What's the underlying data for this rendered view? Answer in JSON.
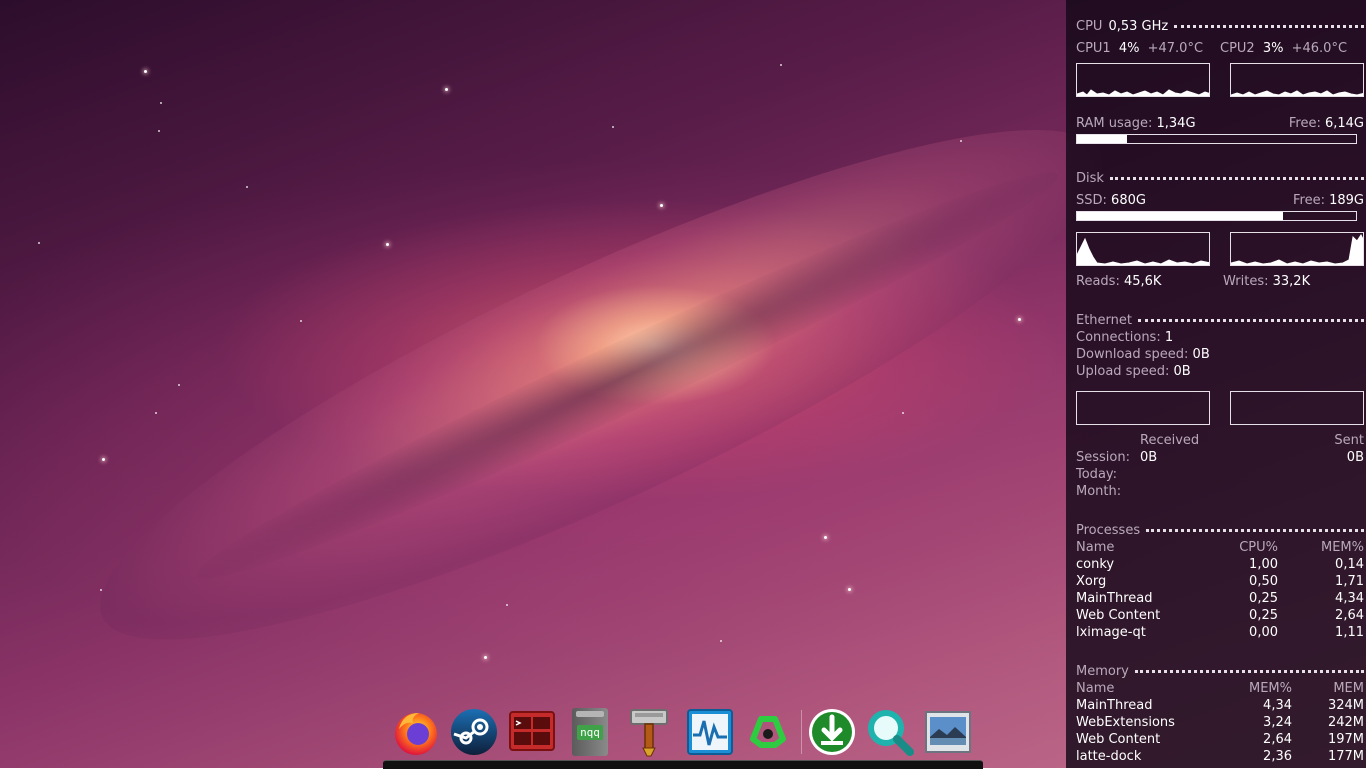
{
  "conky": {
    "cpu": {
      "header_label": "CPU",
      "freq": "0,53 GHz",
      "core1_label": "CPU1",
      "core1_usage": "4%",
      "core1_temp": "+47.0°C",
      "core2_label": "CPU2",
      "core2_usage": "3%",
      "core2_temp": "+46.0°C"
    },
    "ram": {
      "usage_label": "RAM usage:",
      "usage_value": "1,34G",
      "free_label": "Free:",
      "free_value": "6,14G",
      "used_fraction": 0.18
    },
    "disk": {
      "header_label": "Disk",
      "ssd_label": "SSD:",
      "ssd_value": "680G",
      "free_label": "Free:",
      "free_value": "189G",
      "used_fraction": 0.74,
      "reads_label": "Reads:",
      "reads_value": "45,6K",
      "writes_label": "Writes:",
      "writes_value": "33,2K"
    },
    "ethernet": {
      "header_label": "Ethernet",
      "connections_label": "Connections:",
      "connections_value": "1",
      "download_label": "Download speed:",
      "download_value": "0B",
      "upload_label": "Upload speed:",
      "upload_value": "0B",
      "received_label": "Received",
      "sent_label": "Sent",
      "session_label": "Session:",
      "session_received": "0B",
      "session_sent": "0B",
      "today_label": "Today:",
      "month_label": "Month:"
    },
    "processes": {
      "header_label": "Processes",
      "columns": [
        "Name",
        "CPU%",
        "MEM%"
      ],
      "rows": [
        {
          "name": "conky",
          "cpu": "1,00",
          "mem": "0,14"
        },
        {
          "name": "Xorg",
          "cpu": "0,50",
          "mem": "1,71"
        },
        {
          "name": "MainThread",
          "cpu": "0,25",
          "mem": "4,34"
        },
        {
          "name": "Web Content",
          "cpu": "0,25",
          "mem": "2,64"
        },
        {
          "name": "lximage-qt",
          "cpu": "0,00",
          "mem": "1,11"
        }
      ]
    },
    "memory": {
      "header_label": "Memory",
      "columns": [
        "Name",
        "MEM%",
        "MEM"
      ],
      "rows": [
        {
          "name": "MainThread",
          "pct": "4,34",
          "mem": "324M"
        },
        {
          "name": "WebExtensions",
          "pct": "3,24",
          "mem": "242M"
        },
        {
          "name": "Web Content",
          "pct": "2,64",
          "mem": "197M"
        },
        {
          "name": "latte-dock",
          "pct": "2,36",
          "mem": "177M"
        }
      ]
    }
  },
  "dock": {
    "items": [
      {
        "name": "firefox-icon"
      },
      {
        "name": "steam-icon"
      },
      {
        "name": "terminal-icon"
      },
      {
        "name": "notepadqq-icon",
        "label": "nqq"
      },
      {
        "name": "hammer-icon"
      },
      {
        "name": "system-monitor-icon"
      },
      {
        "name": "qbittorrent-icon"
      },
      {
        "name": "downloader-icon"
      },
      {
        "name": "search-icon"
      },
      {
        "name": "image-viewer-icon"
      }
    ]
  },
  "colors": {
    "conky_text": "#cfc3d0",
    "conky_value": "#ffffff",
    "conky_bg": "#140818"
  }
}
